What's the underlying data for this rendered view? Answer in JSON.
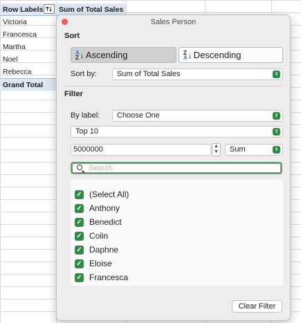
{
  "sheet": {
    "header": {
      "row_labels": "Row Labels",
      "value_header": "Sum of Total Sales"
    },
    "rows": [
      "Victoria",
      "Francesca",
      "Martha",
      "Noel",
      "Rebecca"
    ],
    "grand_total": "Grand Total"
  },
  "panel": {
    "title": "Sales Person",
    "sort": {
      "heading": "Sort",
      "ascending_label": "Ascending",
      "descending_label": "Descending",
      "sort_by_label": "Sort by:",
      "sort_by_value": "Sum of Total Sales"
    },
    "filter": {
      "heading": "Filter",
      "by_label_label": "By label:",
      "by_label_value": "Choose One",
      "top_value": "Top 10",
      "amount_value": "5000000",
      "aggregate_value": "Sum",
      "search_placeholder": "Search",
      "items": [
        "(Select All)",
        "Anthony",
        "Benedict",
        "Colin",
        "Daphne",
        "Eloise",
        "Francesca"
      ]
    },
    "clear_filter_label": "Clear Filter"
  },
  "colors": {
    "accent_green": "#2f8a46",
    "close_red": "#fc5f57",
    "header_blue": "#dde6f3"
  }
}
